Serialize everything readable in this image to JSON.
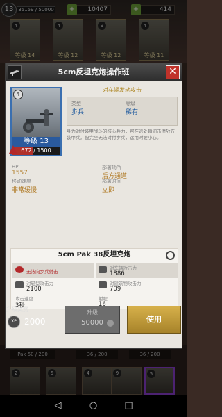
{
  "topbar": {
    "player_level": "13",
    "xp": "35159 / 50000",
    "resource1": "10407",
    "resource2": "414"
  },
  "bg_cards": [
    {
      "num": "4",
      "label": "等级 14"
    },
    {
      "num": "4",
      "label": "等级 12"
    },
    {
      "num": "9",
      "label": "等级 12"
    },
    {
      "num": "4",
      "label": "等级 11"
    }
  ],
  "dialog": {
    "title": "5cm反坦克炮操作班",
    "close": "✕",
    "portrait": {
      "rank": "4",
      "level": "等级 13",
      "xp": "672 / 1500",
      "xp_fraction": 0.448
    },
    "subtitle": "对车辆发动攻击",
    "info": {
      "type_label": "类型",
      "type_value": "步兵",
      "rarity_label": "等级",
      "rarity_value": "稀有"
    },
    "description": "身为对付装甲战斗的核心兵力，可在远处瞬间击溃敌方装甲兵。但完全无法对付步兵，运用时要小心。",
    "stats": [
      {
        "label": "HP",
        "value": "1557"
      },
      {
        "label": "部署场所",
        "value": "后方通道"
      },
      {
        "label": "移动速度",
        "value": "非常缓慢"
      },
      {
        "label": "部署时间",
        "value": "立即"
      }
    ],
    "weapon": {
      "title": "5cm Pak 38反坦克炮",
      "cells": [
        {
          "label": "无法向步兵射击",
          "value": ""
        },
        {
          "label": "对车辆攻击力",
          "value": "1886"
        },
        {
          "label": "对轻型攻击力",
          "value": "2100"
        },
        {
          "label": "对建筑物攻击力",
          "value": "709"
        },
        {
          "label": "攻击速度",
          "value": "3秒"
        },
        {
          "label": "射程",
          "value": "16"
        }
      ]
    }
  },
  "footer": {
    "upgrade_reward_label": "升级奖赏",
    "xp_badge": "XP",
    "xp_value": "2000",
    "upgrade_label": "升级",
    "upgrade_cost": "50000",
    "use_label": "使用"
  },
  "bottom": {
    "strips": [
      "Pak 50 / 200",
      "36 / 200",
      "36 / 200"
    ],
    "cards": [
      {
        "num": "2"
      },
      {
        "num": "5"
      },
      {
        "num": "4"
      },
      {
        "num": "9"
      },
      {
        "num": "5"
      }
    ]
  },
  "navbar": {
    "back": "◁",
    "home": "○",
    "recent": "□"
  }
}
